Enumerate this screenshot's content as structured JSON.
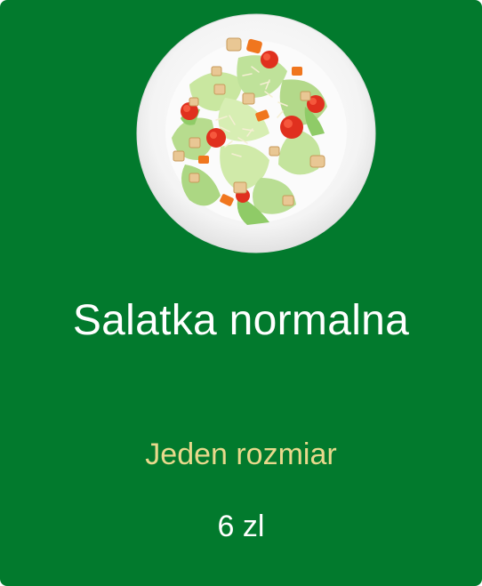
{
  "product": {
    "name": "Salatka normalna",
    "size_label": "Jeden rozmiar",
    "price": "6 zl",
    "image_icon": "salad-bowl-image"
  },
  "colors": {
    "background": "#027a2d",
    "title_text": "#ffffff",
    "size_text": "#e8d98c",
    "price_text": "#ffffff"
  }
}
